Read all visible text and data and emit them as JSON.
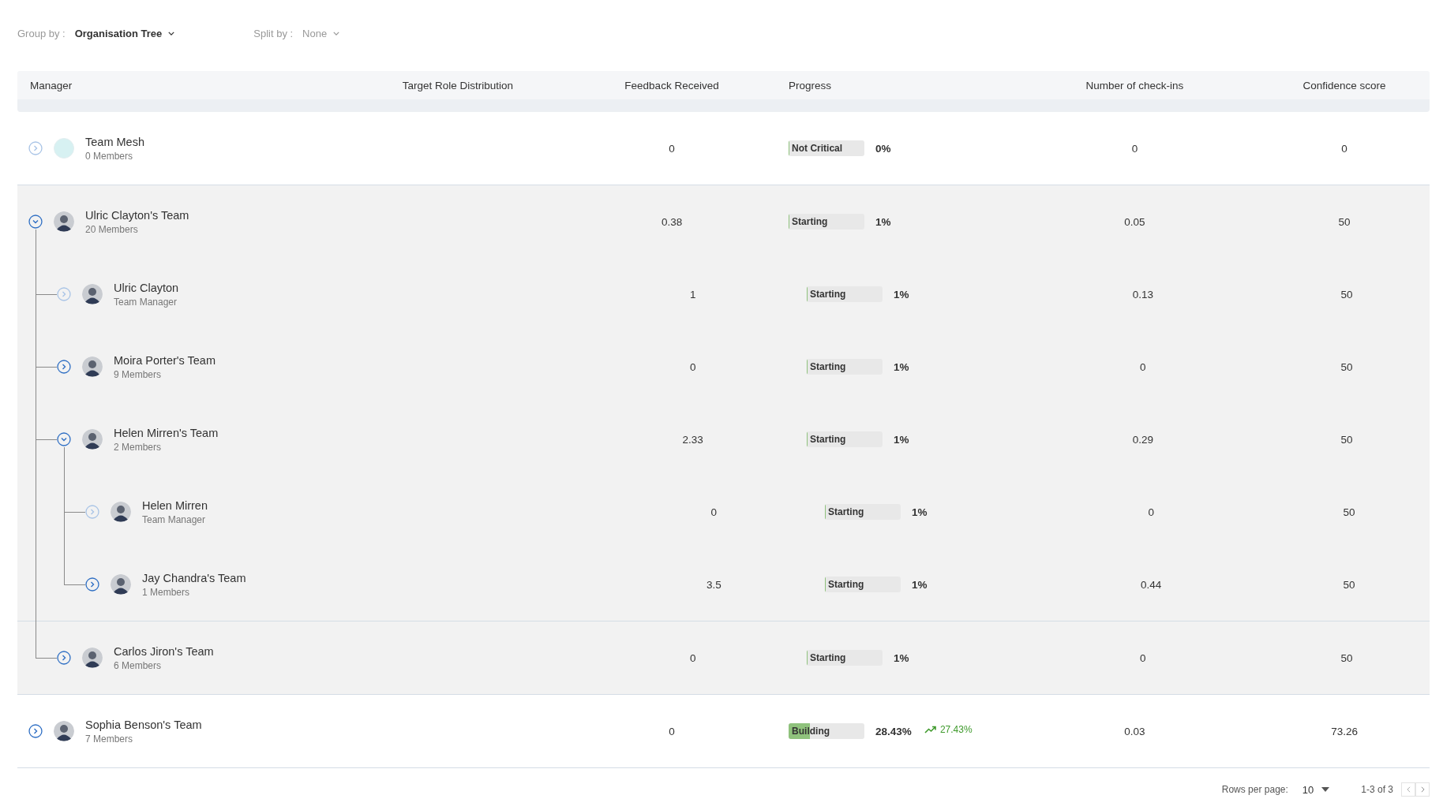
{
  "group_by": {
    "label": "Group by :",
    "value": "Organisation Tree"
  },
  "split_by": {
    "label": "Split by :",
    "value": "None"
  },
  "columns": [
    "Manager",
    "Target Role Distribution",
    "Feedback Received",
    "Progress",
    "Number of check-ins",
    "Confidence score"
  ],
  "rows": [
    {
      "name": "Team Mesh",
      "subtitle": "0 Members",
      "kind": "team",
      "expanded": false,
      "disabled": true,
      "feedback": "0",
      "progress": {
        "label": "Not Critical",
        "level": 0,
        "percent": "0%"
      },
      "checkins": "0",
      "confidence": "0"
    },
    {
      "name": "Ulric Clayton's Team",
      "subtitle": "20 Members",
      "kind": "person",
      "expanded": true,
      "disabled": false,
      "feedback": "0.38",
      "progress": {
        "label": "Starting",
        "level": 0.01,
        "percent": "1%"
      },
      "checkins": "0.05",
      "confidence": "50",
      "children": [
        {
          "name": "Ulric Clayton",
          "subtitle": "Team Manager",
          "kind": "person",
          "expanded": false,
          "disabled": true,
          "feedback": "1",
          "progress": {
            "label": "Starting",
            "level": 0.01,
            "percent": "1%"
          },
          "checkins": "0.13",
          "confidence": "50"
        },
        {
          "name": "Moira Porter's Team",
          "subtitle": "9 Members",
          "kind": "person",
          "expanded": false,
          "disabled": false,
          "feedback": "0",
          "progress": {
            "label": "Starting",
            "level": 0.01,
            "percent": "1%"
          },
          "checkins": "0",
          "confidence": "50"
        },
        {
          "name": "Helen Mirren's Team",
          "subtitle": "2 Members",
          "kind": "person",
          "expanded": true,
          "disabled": false,
          "feedback": "2.33",
          "progress": {
            "label": "Starting",
            "level": 0.01,
            "percent": "1%"
          },
          "checkins": "0.29",
          "confidence": "50",
          "children": [
            {
              "name": "Helen Mirren",
              "subtitle": "Team Manager",
              "kind": "person",
              "expanded": false,
              "disabled": true,
              "feedback": "0",
              "progress": {
                "label": "Starting",
                "level": 0.01,
                "percent": "1%"
              },
              "checkins": "0",
              "confidence": "50"
            },
            {
              "name": "Jay Chandra's Team",
              "subtitle": "1 Members",
              "kind": "person",
              "expanded": false,
              "disabled": false,
              "feedback": "3.5",
              "progress": {
                "label": "Starting",
                "level": 0.01,
                "percent": "1%"
              },
              "checkins": "0.44",
              "confidence": "50"
            }
          ]
        },
        {
          "name": "Carlos Jiron's Team",
          "subtitle": "6 Members",
          "kind": "person",
          "expanded": false,
          "disabled": false,
          "feedback": "0",
          "progress": {
            "label": "Starting",
            "level": 0.01,
            "percent": "1%"
          },
          "checkins": "0",
          "confidence": "50"
        }
      ]
    },
    {
      "name": "Sophia Benson's Team",
      "subtitle": "7 Members",
      "kind": "person",
      "expanded": false,
      "disabled": false,
      "feedback": "0",
      "progress": {
        "label": "Building",
        "level": 0.28,
        "percent": "28.43%",
        "trend": "27.43%"
      },
      "checkins": "0.03",
      "confidence": "73.26"
    }
  ],
  "pagination": {
    "rows_per_page_label": "Rows per page:",
    "rows_per_page": "10",
    "range": "1-3 of 3"
  }
}
